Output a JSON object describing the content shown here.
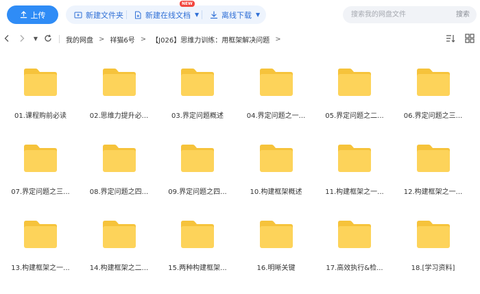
{
  "toolbar": {
    "upload_label": "上传",
    "new_folder_label": "新建文件夹",
    "new_online_doc_label": "新建在线文档",
    "new_badge": "NEW",
    "offline_download_label": "离线下载",
    "search_placeholder": "搜索我的网盘文件",
    "search_button": "搜索"
  },
  "breadcrumb": {
    "items": [
      "我的网盘",
      "祥猫6号",
      "【J026】思维力训练：用框架解决问题"
    ],
    "separator": ">"
  },
  "files": [
    {
      "name": "01.课程购前必读"
    },
    {
      "name": "02.思维力提升必..."
    },
    {
      "name": "03.界定问题概述"
    },
    {
      "name": "04.界定问题之一..."
    },
    {
      "name": "05.界定问题之二..."
    },
    {
      "name": "06.界定问题之三..."
    },
    {
      "name": "07.界定问题之三..."
    },
    {
      "name": "08.界定问题之四..."
    },
    {
      "name": "09.界定问题之四..."
    },
    {
      "name": "10.构建框架概述"
    },
    {
      "name": "11.构建框架之一..."
    },
    {
      "name": "12.构建框架之一..."
    },
    {
      "name": "13.构建框架之一..."
    },
    {
      "name": "14.构建框架之二..."
    },
    {
      "name": "15.两种构建框架..."
    },
    {
      "name": "16.明晰关键"
    },
    {
      "name": "17.高效执行&检..."
    },
    {
      "name": "18.[学习资料]"
    }
  ],
  "colors": {
    "accent": "#2f8cf6",
    "folder": "#fdd35a",
    "folder_tab": "#f6c33b",
    "badge": "#f2463f"
  }
}
